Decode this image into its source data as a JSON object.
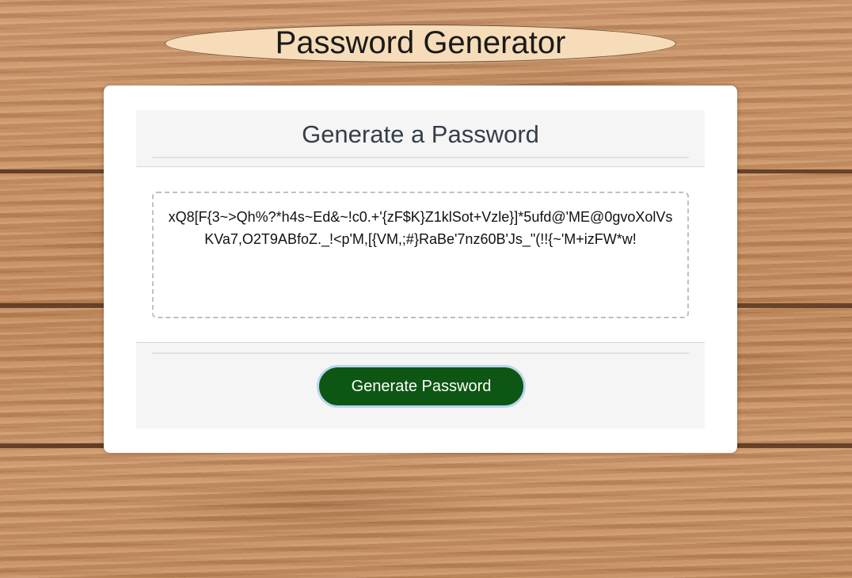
{
  "header": {
    "title": "Password Generator"
  },
  "card": {
    "title": "Generate a Password",
    "password_text": "xQ8[F{3~>Qh%?*h4s~Ed&~!c0.+'{zF$K}Z1klSot+Vzle}]*5ufd@'ME@0gvoXolVsKVa7,O2T9ABfoZ._!<p'M,[{VM,;#}RaBe'7nz60B'Js_\"(!!{~'M+izFW*w!",
    "button_label": "Generate Password"
  },
  "colors": {
    "button_bg": "#0e5614",
    "header_oval_bg": "#f6dcb8",
    "card_panel_bg": "#f5f5f5"
  }
}
